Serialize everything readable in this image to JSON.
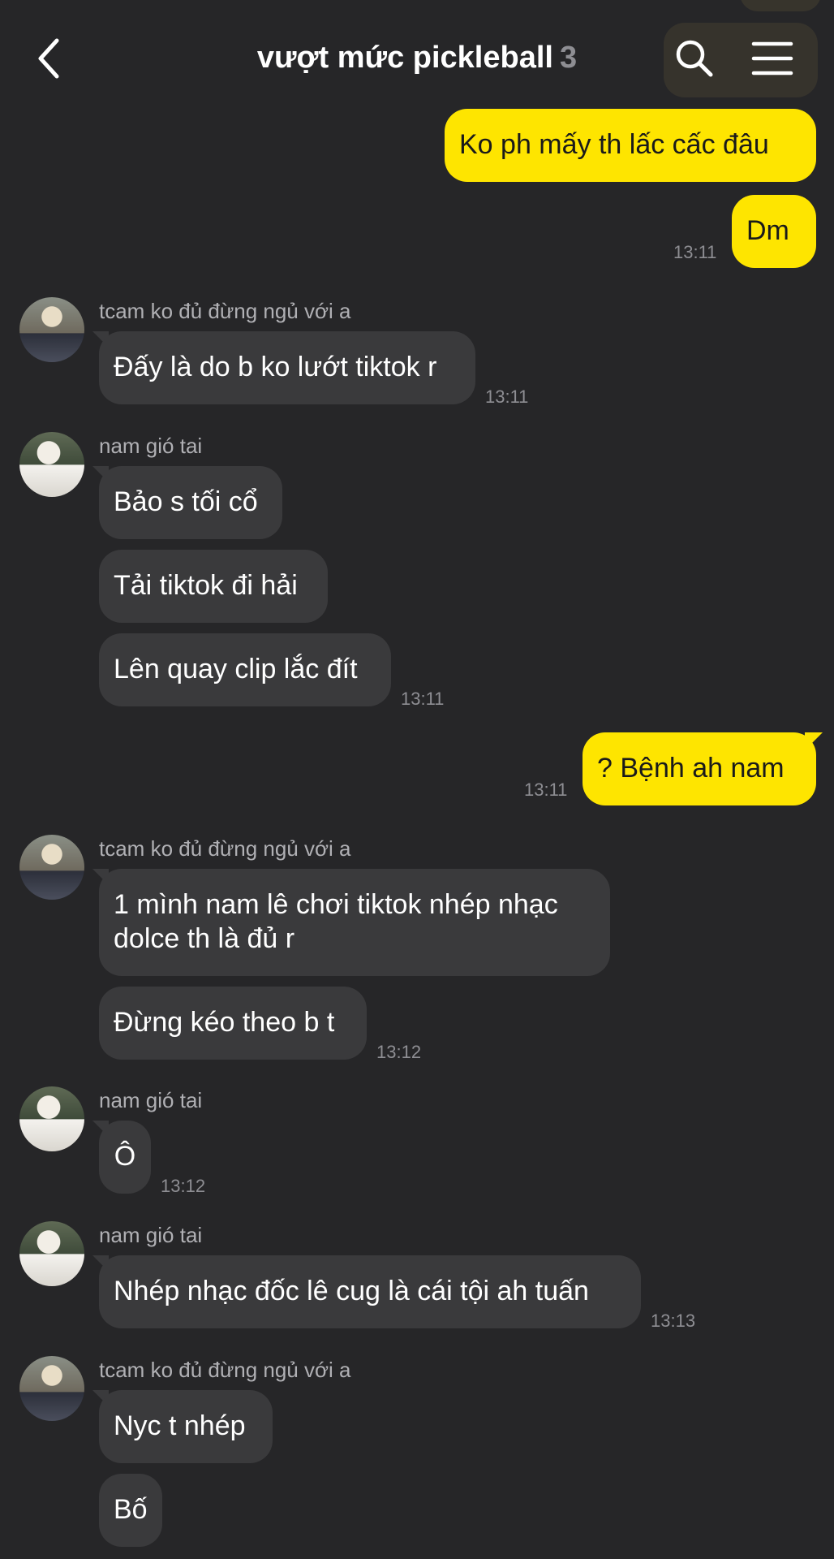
{
  "header": {
    "title": "vượt mức pickleball",
    "member_count": "3"
  },
  "messages": [
    {
      "side": "out",
      "text": "Ko ph mấy th lấc cấc đâu"
    },
    {
      "side": "out",
      "text": "Dm",
      "time": "13:11"
    },
    {
      "sender": "tcam ko đủ đừng ngủ với a",
      "text": "Đấy là do b ko lướt tiktok r",
      "time": "13:11"
    },
    {
      "sender": "nam gió tai",
      "texts": [
        "Bảo s tối cổ",
        "Tải tiktok đi hải",
        "Lên quay clip lắc đít"
      ],
      "time": "13:11"
    },
    {
      "side": "out",
      "text": "? Bệnh ah nam",
      "time": "13:11"
    },
    {
      "sender": "tcam ko đủ đừng ngủ với a",
      "texts": [
        "1 mình nam lê chơi tiktok nhép nhạc",
        "dolce th là đủ r",
        "Đừng kéo theo b t"
      ],
      "time": "13:12"
    },
    {
      "sender": "nam gió tai",
      "text": "Ô",
      "time": "13:12"
    },
    {
      "sender": "nam gió tai",
      "text": "Nhép nhạc đốc lê cug là cái tội ah tuấn",
      "time": "13:13"
    },
    {
      "sender": "tcam ko đủ đừng ngủ với a",
      "texts": [
        "Nyc t nhép",
        "Bố"
      ]
    }
  ],
  "icons": {
    "back": "chevron-left-icon",
    "search": "search-icon",
    "menu": "hamburger-menu-icon"
  },
  "colors": {
    "background": "#262628",
    "outgoing_bubble": "#fee500",
    "incoming_bubble": "#3a3a3c",
    "timestamp": "#8e8e93"
  }
}
